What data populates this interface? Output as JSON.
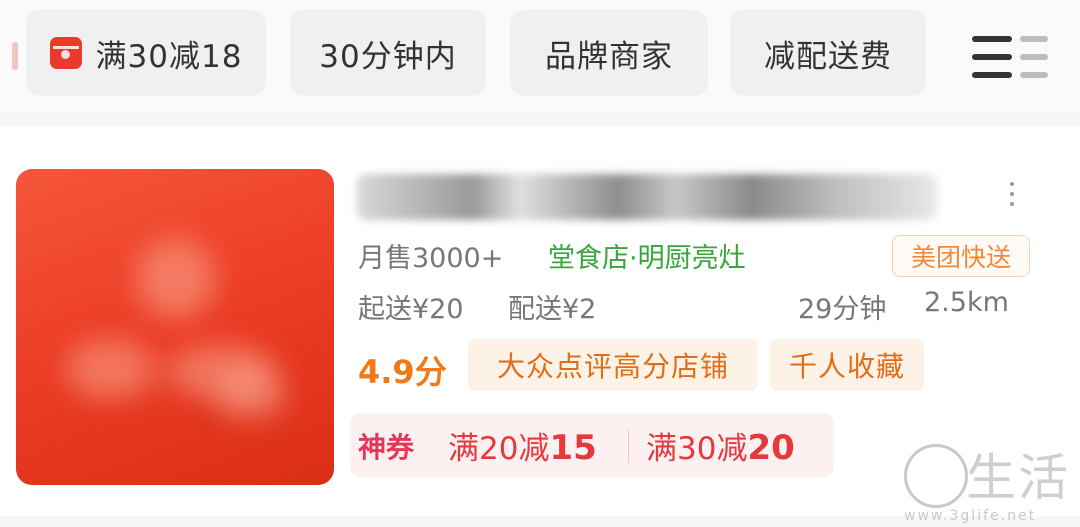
{
  "filters": {
    "chips": [
      {
        "label": "满30减18",
        "icon": "red-packet-icon"
      },
      {
        "label": "30分钟内"
      },
      {
        "label": "品牌商家"
      },
      {
        "label": "减配送费"
      }
    ],
    "menu_icon": "list-menu-icon"
  },
  "shop": {
    "monthly_sales": "月售3000+",
    "dine_in_tag": "堂食店·明厨亮灶",
    "delivery_badge": "美团快送",
    "min_order": "起送¥20",
    "delivery_fee": "配送¥2",
    "delivery_time": "29分钟",
    "distance": "2.5km",
    "rating": "4.9分",
    "tags": [
      "大众点评高分店铺",
      "千人收藏"
    ],
    "coupon_label": "神券",
    "coupons": [
      {
        "prefix": "满20减",
        "amount": "15"
      },
      {
        "prefix": "满30减",
        "amount": "20"
      }
    ]
  },
  "watermark": {
    "text": "生活",
    "url": "www.3glife.net"
  },
  "colors": {
    "accent_red": "#ea3a2b",
    "rating_orange": "#f07a18",
    "green_tag": "#3aa53d",
    "coupon_red": "#e5393c"
  }
}
